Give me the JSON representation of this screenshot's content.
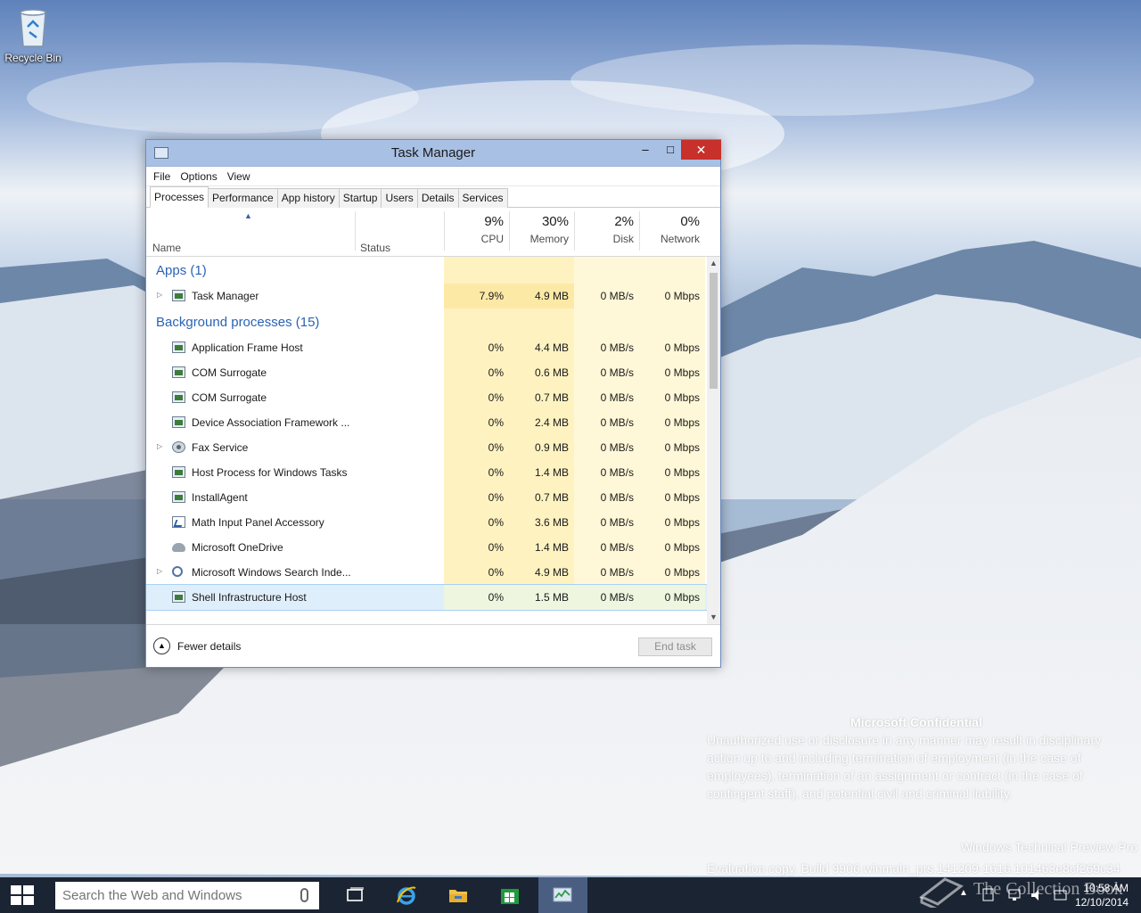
{
  "desktop": {
    "recycle_bin_label": "Recycle Bin"
  },
  "task_manager": {
    "title": "Task Manager",
    "window_buttons": {
      "minimize": "–",
      "maximize": "□",
      "close": "✕"
    },
    "menu": [
      "File",
      "Options",
      "View"
    ],
    "tabs": [
      "Processes",
      "Performance",
      "App history",
      "Startup",
      "Users",
      "Details",
      "Services"
    ],
    "active_tab": "Processes",
    "columns": {
      "name": "Name",
      "status": "Status",
      "cpu": {
        "pct": "9%",
        "label": "CPU"
      },
      "memory": {
        "pct": "30%",
        "label": "Memory"
      },
      "disk": {
        "pct": "2%",
        "label": "Disk"
      },
      "network": {
        "pct": "0%",
        "label": "Network"
      }
    },
    "groups": {
      "apps": "Apps (1)",
      "background": "Background processes (15)"
    },
    "apps": [
      {
        "name": "Task Manager",
        "cpu": "7.9%",
        "mem": "4.9 MB",
        "disk": "0 MB/s",
        "net": "0 Mbps",
        "icon": "task-manager-icon"
      }
    ],
    "background": [
      {
        "name": "Application Frame Host",
        "cpu": "0%",
        "mem": "4.4 MB",
        "disk": "0 MB/s",
        "net": "0 Mbps",
        "icon": "app-window-icon"
      },
      {
        "name": "COM Surrogate",
        "cpu": "0%",
        "mem": "0.6 MB",
        "disk": "0 MB/s",
        "net": "0 Mbps",
        "icon": "app-window-icon"
      },
      {
        "name": "COM Surrogate",
        "cpu": "0%",
        "mem": "0.7 MB",
        "disk": "0 MB/s",
        "net": "0 Mbps",
        "icon": "app-window-icon"
      },
      {
        "name": "Device Association Framework ...",
        "cpu": "0%",
        "mem": "2.4 MB",
        "disk": "0 MB/s",
        "net": "0 Mbps",
        "icon": "app-window-icon"
      },
      {
        "name": "Fax Service",
        "cpu": "0%",
        "mem": "0.9 MB",
        "disk": "0 MB/s",
        "net": "0 Mbps",
        "icon": "gear-icon"
      },
      {
        "name": "Host Process for Windows Tasks",
        "cpu": "0%",
        "mem": "1.4 MB",
        "disk": "0 MB/s",
        "net": "0 Mbps",
        "icon": "app-window-icon"
      },
      {
        "name": "InstallAgent",
        "cpu": "0%",
        "mem": "0.7 MB",
        "disk": "0 MB/s",
        "net": "0 Mbps",
        "icon": "app-window-icon"
      },
      {
        "name": "Math Input Panel Accessory",
        "cpu": "0%",
        "mem": "3.6 MB",
        "disk": "0 MB/s",
        "net": "0 Mbps",
        "icon": "math-input-icon"
      },
      {
        "name": "Microsoft OneDrive",
        "cpu": "0%",
        "mem": "1.4 MB",
        "disk": "0 MB/s",
        "net": "0 Mbps",
        "icon": "cloud-icon"
      },
      {
        "name": "Microsoft Windows Search Inde...",
        "cpu": "0%",
        "mem": "4.9 MB",
        "disk": "0 MB/s",
        "net": "0 Mbps",
        "icon": "search-indexer-icon"
      },
      {
        "name": "Shell Infrastructure Host",
        "cpu": "0%",
        "mem": "1.5 MB",
        "disk": "0 MB/s",
        "net": "0 Mbps",
        "icon": "app-window-icon"
      }
    ],
    "footer": {
      "fewer_details": "Fewer details",
      "end_task": "End task"
    }
  },
  "confidential": {
    "title": "Microsoft Confidential",
    "body": "Unauthorized use or disclosure in any manner may result in disciplinary action up to and including termination of employment (in the case of employees), termination of an assignment or contract (in the case of contingent staff), and potential civil and criminal liability."
  },
  "build": {
    "edition": "Windows Technical Preview Pro",
    "evaluation": "Evaluation copy. Build 9906.winmain_prs.141209-1616.101463e8cf269c34"
  },
  "taskbar": {
    "search_placeholder": "Search the Web and Windows",
    "time": "10:58 AM",
    "date": "12/10/2014"
  },
  "overlay_watermark": "The Collection Book",
  "colors": {
    "accent_blue": "#2a63b5",
    "close_red": "#c7302b",
    "heat_yellow": "#fff2c1",
    "taskbar": "#1b2433"
  }
}
